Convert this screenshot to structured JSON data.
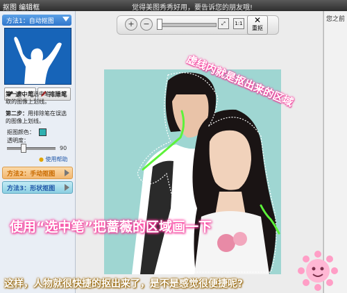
{
  "titlebar": {
    "app_title": "抠图 编辑框",
    "marquee": "觉得美图秀秀好用，要告诉您的朋友哦!"
  },
  "sidebar": {
    "method1_label": "方法1：自动抠图",
    "select_pen_label": "选中笔",
    "erase_pen_label": "排除笔",
    "step1_title": "第一步：",
    "step1_text": "用选中笔在要抠取的图像上划线。",
    "step2_title": "第二步：",
    "step2_text": "用排除笔在误选的图像上划线。",
    "border_color_label": "抠图颜色：",
    "border_color": "#2fb0b0",
    "opacity_label": "透明度：",
    "opacity_value": "90",
    "help_label": "使用帮助",
    "method2_label": "方法2：手动抠图",
    "method3_label": "方法3：形状抠图"
  },
  "toolbar": {
    "zoom_in_icon": "zoom-in-icon",
    "zoom_out_icon": "zoom-out-icon",
    "reset_label": "重抠"
  },
  "right_panel": {
    "label": "您之前"
  },
  "annotations": {
    "note1": "虚线内就是抠出来的区域",
    "note2": "使用“选中笔”把蔷薇的区域画一下",
    "note3": "这样，人物就很快捷的抠出来了，是不是感觉很便捷呢?"
  },
  "colors": {
    "accent_blue": "#2f76cc",
    "method2_bg": "#f6c489",
    "method3_bg": "#9fd8e6",
    "annotation_pink": "#ff3fa0",
    "selection_green": "#5df23a"
  }
}
